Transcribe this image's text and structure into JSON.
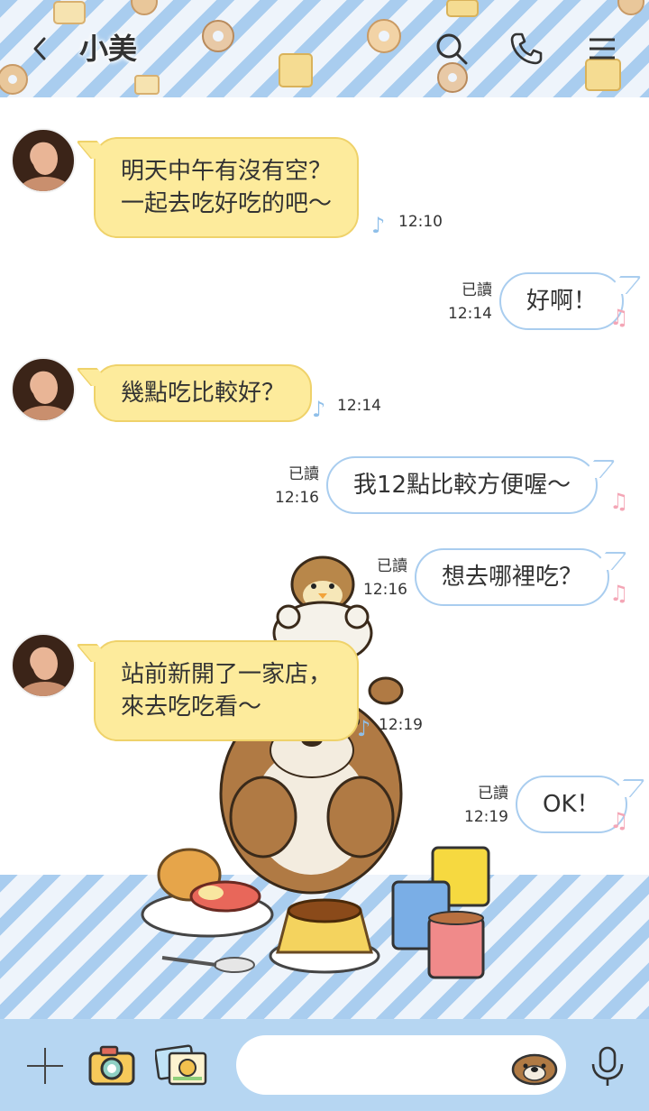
{
  "header": {
    "title": "小美"
  },
  "messages": [
    {
      "side": "in",
      "lines": [
        "明天中午有沒有空？",
        "一起去吃好吃的吧～"
      ],
      "time": "12:10"
    },
    {
      "side": "out",
      "text": "好啊！",
      "read": "已讀",
      "time": "12:14"
    },
    {
      "side": "in",
      "lines": [
        "幾點吃比較好？"
      ],
      "time": "12:14"
    },
    {
      "side": "out",
      "text": "我12點比較方便喔～",
      "read": "已讀",
      "time": "12:16"
    },
    {
      "side": "out",
      "text": "想去哪裡吃？",
      "read": "已讀",
      "time": "12:16"
    },
    {
      "side": "in",
      "lines": [
        "站前新開了一家店，",
        "來去吃吃看～"
      ],
      "time": "12:19"
    },
    {
      "side": "out",
      "text": "OK！",
      "read": "已讀",
      "time": "12:19"
    }
  ],
  "input": {
    "value": "",
    "placeholder": ""
  },
  "icons": {
    "back": "chevron-left-icon",
    "search": "search-icon",
    "call": "phone-icon",
    "menu": "menu-icon",
    "plus": "plus-icon",
    "camera": "camera-icon",
    "gallery": "gallery-icon",
    "sticker": "otter-sticker-icon",
    "mic": "mic-icon"
  },
  "colors": {
    "incoming_bubble": "#fdeb9c",
    "outgoing_border": "#a9cdef",
    "bottom_bar": "#b6d6f2"
  }
}
